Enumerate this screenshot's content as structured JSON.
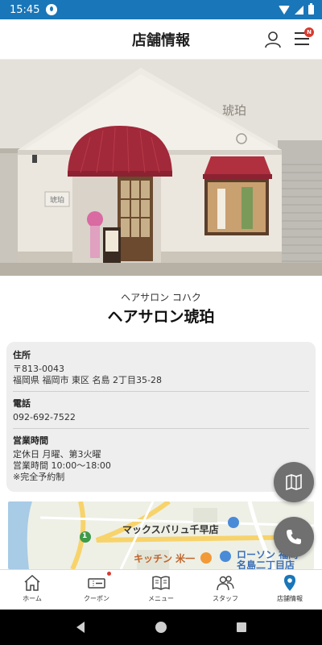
{
  "status_bar": {
    "time": "15:45"
  },
  "header": {
    "title": "店舗情報"
  },
  "hero": {
    "sign_text": "琥珀",
    "small_sign_text": "琥珀"
  },
  "shop": {
    "name_kana": "ヘアサロン コハク",
    "name": "ヘアサロン琥珀"
  },
  "info": {
    "address_label": "住所",
    "postal": "〒813-0043",
    "address": "福岡県 福岡市 東区 名島 2丁目35-28",
    "phone_label": "電話",
    "phone": "092-692-7522",
    "hours_label": "営業時間",
    "closed": "定休日 月曜、第3火曜",
    "hours": "営業時間 10:00～18:00",
    "note": "※完全予約制"
  },
  "map": {
    "poi_1": "マックスバリュ千早店",
    "poi_2": "キッチン 米一",
    "poi_3": "ローソン 福岡名島二丁目店",
    "route_number": "1"
  },
  "bottom_nav": [
    {
      "label": "ホーム",
      "icon": "home-icon"
    },
    {
      "label": "クーポン",
      "icon": "coupon-icon"
    },
    {
      "label": "メニュー",
      "icon": "menu-book-icon"
    },
    {
      "label": "スタッフ",
      "icon": "staff-icon"
    },
    {
      "label": "店舗情報",
      "icon": "location-pin-icon",
      "active": true
    }
  ],
  "colors": {
    "accent": "#1976b8",
    "badge": "#d83a2e",
    "awning": "#a2293a"
  },
  "header_badge": "N"
}
